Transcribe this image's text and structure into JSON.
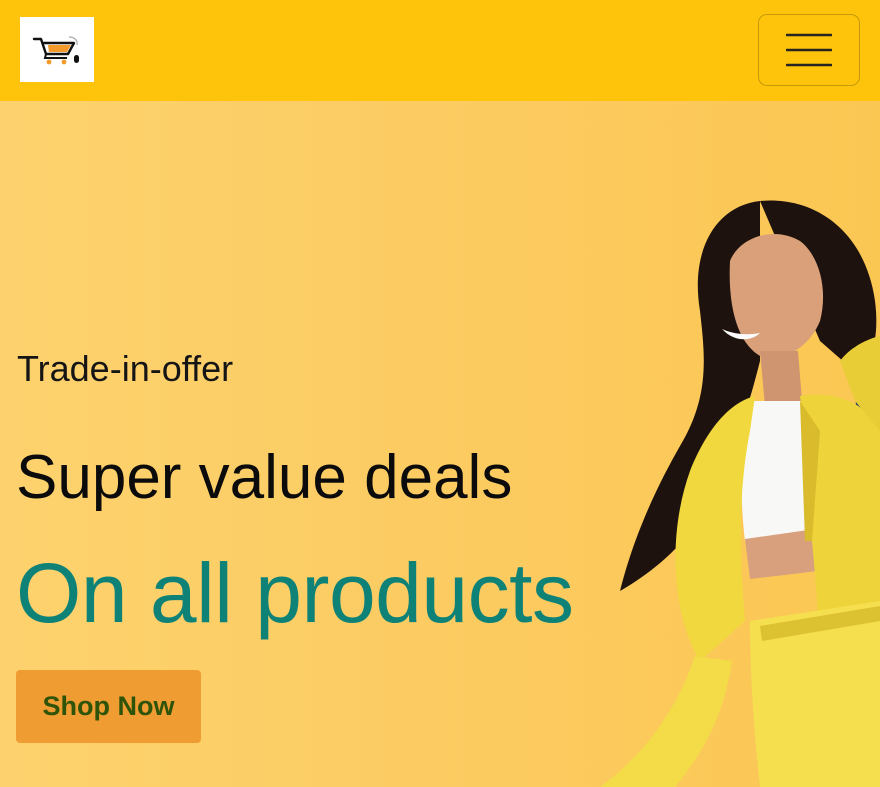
{
  "header": {
    "logo_icon": "shopping-cart-icon",
    "menu_icon": "hamburger-menu-icon"
  },
  "hero": {
    "eyebrow": "Trade-in-offer",
    "headline": "Super value deals",
    "subheadline": "On all products",
    "cta_label": "Shop Now",
    "image": "woman-in-yellow-jacket-shopping-photo"
  },
  "colors": {
    "navbar": "#fdc40b",
    "hero_background": "#fccc63",
    "accent_teal": "#0f8277",
    "cta_background": "#ef9c32",
    "cta_text": "#2f5309"
  }
}
